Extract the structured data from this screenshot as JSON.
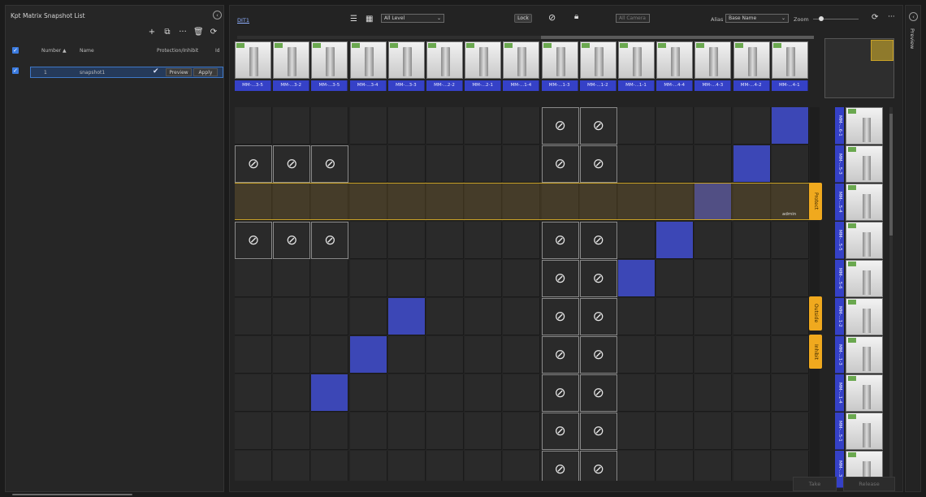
{
  "left_panel": {
    "title": "Kpt Matrix Snapshot List",
    "toolbar": {
      "add": "+",
      "copy": "⧉",
      "more": "···",
      "delete": "🗑",
      "refresh": "⟳"
    },
    "columns": [
      "Number ▲",
      "Name",
      "Protection/Inhibit",
      "Id"
    ],
    "rows": [
      {
        "number": "1",
        "name": "snapshot1",
        "preview_label": "Preview",
        "apply_label": "Apply"
      }
    ]
  },
  "top_bar": {
    "tab_label": "DIT1",
    "level_select": "All Level",
    "lock_label": "Lock",
    "channel_select": "All Camera",
    "alias_label": "Alias",
    "alias_select": "Base Name",
    "zoom_label": "Zoom"
  },
  "source_labels": [
    "MM-...3-5",
    "MM-...3-2",
    "MM-...3-5",
    "MM-...3-4",
    "MM-...3-3",
    "MM-...2-2",
    "MM-...2-1",
    "MM-...1-4",
    "MM-...1-3",
    "MM-...1-2",
    "MM-...1-1",
    "MM-...4-4",
    "MM-...4-3",
    "MM-...4-2",
    "MM-...4-1"
  ],
  "dest_labels": [
    "MM-...6-1",
    "MM-...5-3",
    "MM-...5-4",
    "MM-...5-5",
    "MM-...5-6",
    "MM-...1-2",
    "MM-...1-3",
    "MM-...1-4",
    "MM-...5-1",
    "MM-...3"
  ],
  "tags": {
    "protect": "Protect",
    "owner": "admin",
    "outside": "Outside",
    "inhibit": "Inhibit"
  },
  "crosspoints": [
    {
      "row": 0,
      "col": 14
    },
    {
      "row": 1,
      "col": 13
    },
    {
      "row": 2,
      "col": 12
    },
    {
      "row": 3,
      "col": 11
    },
    {
      "row": 4,
      "col": 10
    },
    {
      "row": 5,
      "col": 4
    },
    {
      "row": 6,
      "col": 3
    },
    {
      "row": 7,
      "col": 2
    }
  ],
  "blocked": [
    {
      "row": 0,
      "col": 8
    },
    {
      "row": 0,
      "col": 9
    },
    {
      "row": 1,
      "col": 0
    },
    {
      "row": 1,
      "col": 1
    },
    {
      "row": 1,
      "col": 2
    },
    {
      "row": 1,
      "col": 8
    },
    {
      "row": 1,
      "col": 9
    },
    {
      "row": 3,
      "col": 0
    },
    {
      "row": 3,
      "col": 1
    },
    {
      "row": 3,
      "col": 2
    },
    {
      "row": 3,
      "col": 8
    },
    {
      "row": 3,
      "col": 9
    },
    {
      "row": 4,
      "col": 8
    },
    {
      "row": 4,
      "col": 9
    },
    {
      "row": 5,
      "col": 8
    },
    {
      "row": 5,
      "col": 9
    },
    {
      "row": 6,
      "col": 8
    },
    {
      "row": 6,
      "col": 9
    },
    {
      "row": 7,
      "col": 8
    },
    {
      "row": 7,
      "col": 9
    },
    {
      "row": 8,
      "col": 8
    },
    {
      "row": 8,
      "col": 9
    },
    {
      "row": 9,
      "col": 8
    },
    {
      "row": 9,
      "col": 9
    }
  ],
  "bottom_buttons": {
    "take": "Take",
    "release": "Release"
  },
  "preview_title": "Preview",
  "colors": {
    "crosspoint": "#3c47b6",
    "protect": "#c9a227",
    "label": "#3541c7"
  }
}
